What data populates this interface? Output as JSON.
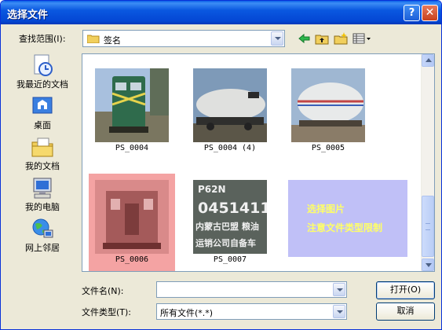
{
  "window": {
    "title": "选择文件"
  },
  "titlebar": {
    "help": "?",
    "close": "✕"
  },
  "lookin": {
    "label": "查找范围(I):",
    "value": "签名"
  },
  "toolbar": {
    "icons": [
      "back-icon",
      "up-folder-icon",
      "new-folder-icon",
      "view-menu-icon"
    ]
  },
  "places": [
    {
      "label": "我最近的文档",
      "icon": "recent-documents-icon"
    },
    {
      "label": "桌面",
      "icon": "desktop-icon"
    },
    {
      "label": "我的文档",
      "icon": "my-documents-icon"
    },
    {
      "label": "我的电脑",
      "icon": "my-computer-icon"
    },
    {
      "label": "网上邻居",
      "icon": "network-places-icon"
    }
  ],
  "files": [
    {
      "name": "PS_0004"
    },
    {
      "name": "PS_0004 (4)"
    },
    {
      "name": "PS_0005"
    },
    {
      "name": "PS_0006",
      "selected": true
    },
    {
      "name": "PS_0007",
      "thumb_text": [
        "P62N",
        "0451411",
        "内蒙古巴盟 粮油",
        "运销公司自备车"
      ]
    }
  ],
  "notice": {
    "line1": "选择图片",
    "line2": "注意文件类型限制",
    "bg": "#c0c0f7",
    "fg": "#ffff66"
  },
  "filename": {
    "label": "文件名(N):",
    "value": ""
  },
  "filetype": {
    "label": "文件类型(T):",
    "value": "所有文件(*.*)"
  },
  "buttons": {
    "open": "打开(O)",
    "cancel": "取消"
  }
}
